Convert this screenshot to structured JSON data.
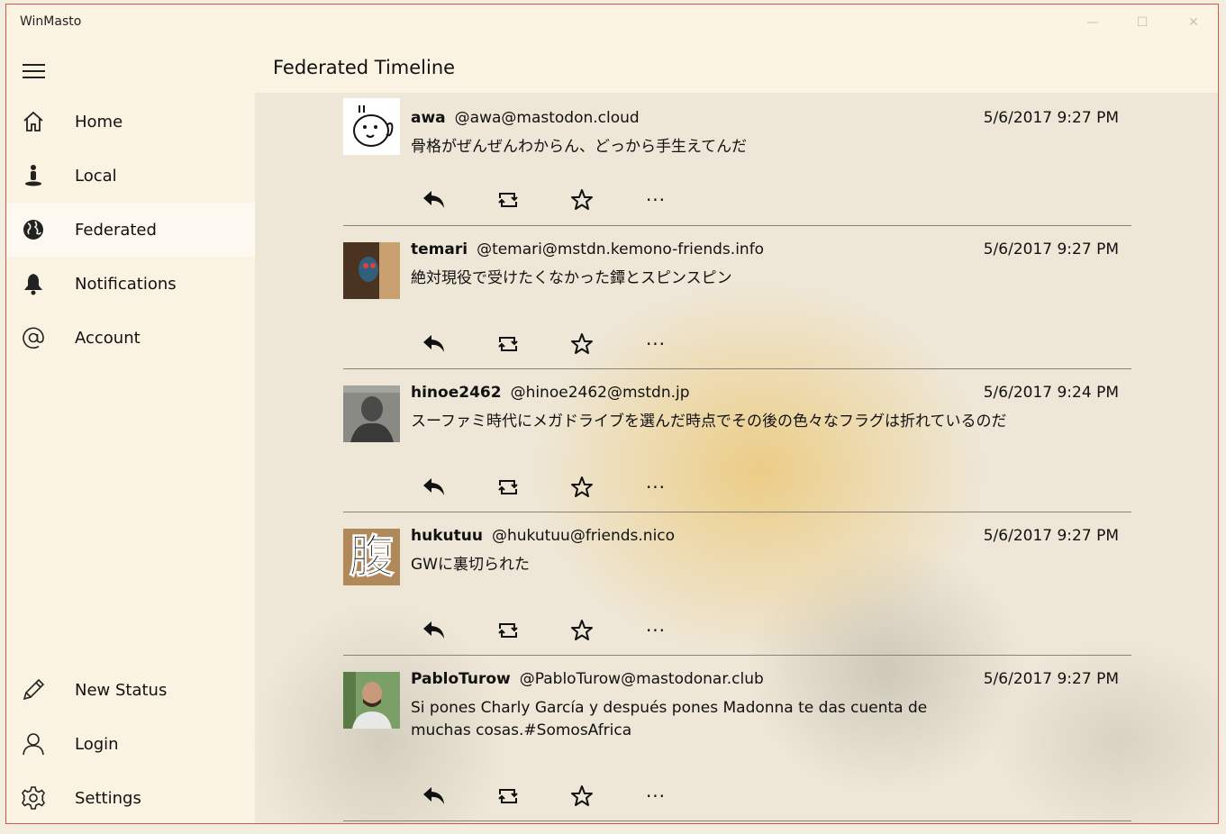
{
  "window": {
    "title": "WinMasto",
    "controls": {
      "minimize": "—",
      "maximize": "☐",
      "close": "✕"
    }
  },
  "header": {
    "title": "Federated Timeline"
  },
  "sidebar": {
    "menu_icon": "hamburger-icon",
    "items": [
      {
        "label": "Home",
        "icon": "home-icon",
        "selected": false
      },
      {
        "label": "Local",
        "icon": "person-icon",
        "selected": false
      },
      {
        "label": "Federated",
        "icon": "globe-icon",
        "selected": true
      },
      {
        "label": "Notifications",
        "icon": "bell-icon",
        "selected": false
      },
      {
        "label": "Account",
        "icon": "at-icon",
        "selected": false
      }
    ],
    "bottom_items": [
      {
        "label": "New Status",
        "icon": "pencil-icon"
      },
      {
        "label": "Login",
        "icon": "user-icon"
      },
      {
        "label": "Settings",
        "icon": "gear-icon"
      }
    ]
  },
  "statuses": [
    {
      "display_name": "awa",
      "acct": "@awa@mastodon.cloud",
      "timestamp": "5/6/2017 9:27 PM",
      "content": "骨格がぜんぜんわからん、どっから手生えてんだ"
    },
    {
      "display_name": "temari",
      "acct": "@temari@mstdn.kemono-friends.info",
      "timestamp": "5/6/2017 9:27 PM",
      "content": "絶対現役で受けたくなかった鐔とスピンスピン"
    },
    {
      "display_name": "hinoe2462",
      "acct": "@hinoe2462@mstdn.jp",
      "timestamp": "5/6/2017 9:24 PM",
      "content": "スーファミ時代にメガドライブを選んだ時点でその後の色々なフラグは折れているのだ"
    },
    {
      "display_name": "hukutuu",
      "acct": "@hukutuu@friends.nico",
      "timestamp": "5/6/2017 9:27 PM",
      "content": "GWに裏切られた",
      "avatar_text": "腹"
    },
    {
      "display_name": "PabloTurow",
      "acct": "@PabloTurow@mastodonar.club",
      "timestamp": "5/6/2017 9:27 PM",
      "content": "Si pones Charly García y después pones Madonna te das cuenta de muchas cosas.#SomosAfrica"
    }
  ],
  "actions": {
    "reply_icon": "reply-icon",
    "boost_icon": "boost-icon",
    "favourite_icon": "star-icon",
    "more_label": "···"
  },
  "colors": {
    "window_border": "#d9534f",
    "sidebar_bg": "#fbf3e1",
    "selected_bg": "#fdf9f0",
    "accent_glow": "#ebc878"
  }
}
